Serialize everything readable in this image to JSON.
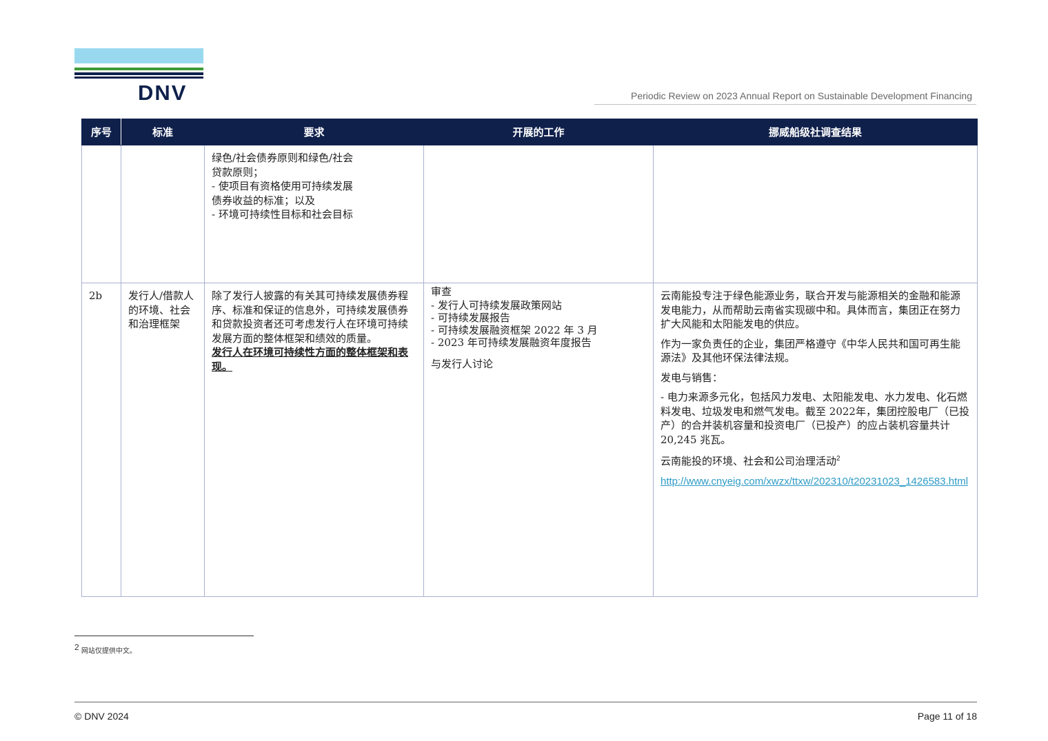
{
  "header": {
    "logo_text": "DNV",
    "logo_colors": [
      "#99d9ef",
      "#3f9c35",
      "#0f204b"
    ],
    "title": "Periodic Review on 2023 Annual Report on Sustainable Development Financing"
  },
  "table": {
    "columns": [
      "序号",
      "标准",
      "要求",
      "开展的工作",
      "挪威船级社调查结果"
    ],
    "header_bg": "#0f204b",
    "row1": {
      "no": "",
      "criteria": "",
      "requirement_lines": [
        "绿色/社会债券原则和绿色/社会",
        "贷款原则；",
        "- 使项目有资格使用可持续发展",
        "债券收益的标准；以及",
        "- 环境可持续性目标和社会目标"
      ],
      "work": "",
      "findings": ""
    },
    "row2": {
      "no": "2b",
      "criteria": "发行人/借款人的环境、社会和治理框架",
      "requirement": "除了发行人披露的有关其可持续发展债券程序、标准和保证的信息外，可持续发展债券和贷款投资者还可考虑发行人在环境可持续发展方面的整体框架和绩效的质量。",
      "requirement_bold": "发行人在环境可持续性方面的整体框架和表现。",
      "work_lines": [
        "审查",
        "- 发行人可持续发展政策网站",
        "- 可持续发展报告",
        "- 可持续发展融资框架 2022 年 3 月",
        "- 2023 年可持续发展融资年度报告"
      ],
      "work_discussion": "与发行人讨论",
      "findings": {
        "p1": "云南能投专注于绿色能源业务，联合开发与能源相关的金融和能源发电能力，从而帮助云南省实现碳中和。具体而言，集团正在努力扩大风能和太阳能发电的供应。",
        "p2": "作为一家负责任的企业，集团严格遵守《中华人民共和国可再生能源法》及其他环保法律法规。",
        "p3": "发电与销售：",
        "p4": "- 电力来源多元化，包括风力发电、太阳能发电、水力发电、化石燃料发电、垃圾发电和燃气发电。截至 2022年，集团控股电厂（已投产）的合并装机容量和投资电厂（已投产）的应占装机容量共计 20,245 兆瓦。",
        "p5": "云南能投的环境、社会和公司治理活动",
        "p5_sup": "2",
        "link": "http://www.cnyeig.com/xwzx/ttxw/202310/t20231023_1426583.html",
        "link_color": "#2e9bc6"
      }
    }
  },
  "footnote": {
    "number": "2",
    "text": "网站仅提供中文。"
  },
  "footer": {
    "copyright": "© DNV 2024",
    "page": "Page 11 of 18"
  }
}
